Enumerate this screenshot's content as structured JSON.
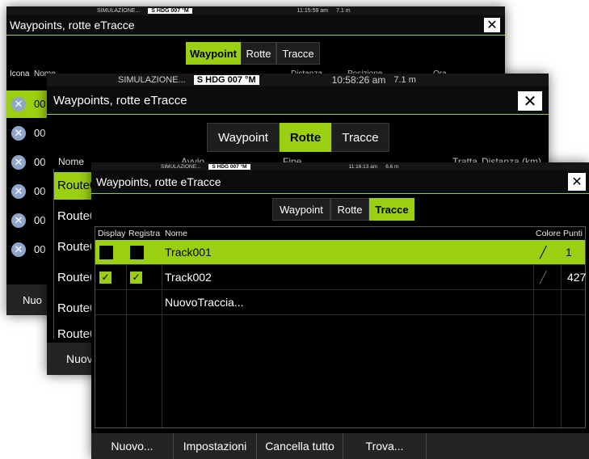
{
  "window_back": {
    "status": {
      "simulation": "SIMULAZIONE...",
      "heading": "S HDG 007 °M",
      "time": "11:15:59 am",
      "range": "7.1 m"
    },
    "title": "Waypoints, rotte eTracce",
    "tabs": [
      "Waypoint",
      "Rotte",
      "Tracce"
    ],
    "active_tab": "Waypoint",
    "columns": [
      "Icona",
      "Nome",
      "Distanza",
      "Posizione",
      "Ora"
    ],
    "row_names": [
      "00",
      "00",
      "00",
      "00",
      "00",
      "00"
    ],
    "bottom_button": "Nuo"
  },
  "window_middle": {
    "status": {
      "simulation": "SIMULAZIONE...",
      "heading": "S HDG 007 °M",
      "time": "10:58:26 am",
      "range": "7.1 m"
    },
    "title": "Waypoints, rotte eTracce",
    "tabs": [
      "Waypoint",
      "Rotte",
      "Tracce"
    ],
    "active_tab": "Rotte",
    "columns": [
      "Nome",
      "Avvio",
      "Fine",
      "Tratta",
      "Distanza (km)"
    ],
    "row_names": [
      "Route0",
      "Route0",
      "Route0",
      "Route0",
      "Route0",
      "Route0"
    ],
    "bottom_button": "Nuov"
  },
  "window_front": {
    "status": {
      "simulation": "SIMULAZIONE...",
      "heading": "S HDG 007 °M",
      "time": "11:16:13 am",
      "range": "6.6 m"
    },
    "title": "Waypoints, rotte eTracce",
    "tabs": [
      "Waypoint",
      "Rotte",
      "Tracce"
    ],
    "active_tab": "Tracce",
    "columns": {
      "display": "Display",
      "record": "Registra",
      "name": "Nome",
      "color": "Colore",
      "points": "Punti"
    },
    "rows": [
      {
        "name": "Track001",
        "display": false,
        "record": false,
        "points": "1",
        "selected": true
      },
      {
        "name": "Track002",
        "display": true,
        "record": true,
        "points": "427",
        "selected": false
      },
      {
        "name": "NuovoTraccia...",
        "display": null,
        "record": null,
        "points": "",
        "selected": false
      }
    ],
    "buttons": [
      "Nuovo...",
      "Impostazioni",
      "Cancella tutto",
      "Trova..."
    ]
  },
  "colors": {
    "accent": "#9bd012",
    "background": "#000000",
    "icon_blue": "#8fa6c8"
  }
}
